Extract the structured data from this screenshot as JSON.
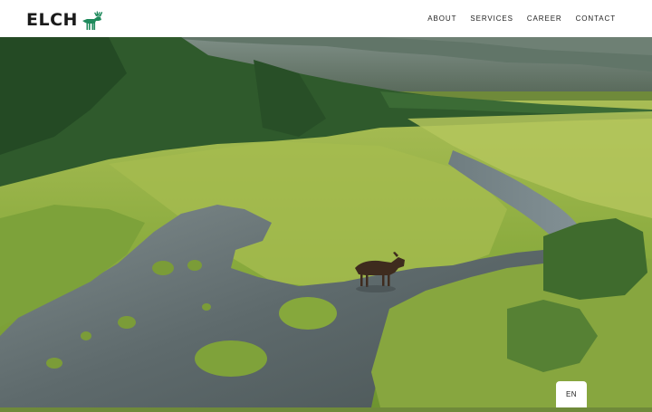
{
  "brand": {
    "name": "ELCH",
    "icon": "moose-icon",
    "icon_color": "#1f8a5c"
  },
  "nav": {
    "items": [
      {
        "label": "ABOUT"
      },
      {
        "label": "SERVICES"
      },
      {
        "label": "CAREER"
      },
      {
        "label": "CONTACT"
      }
    ]
  },
  "language": {
    "label": "EN"
  }
}
